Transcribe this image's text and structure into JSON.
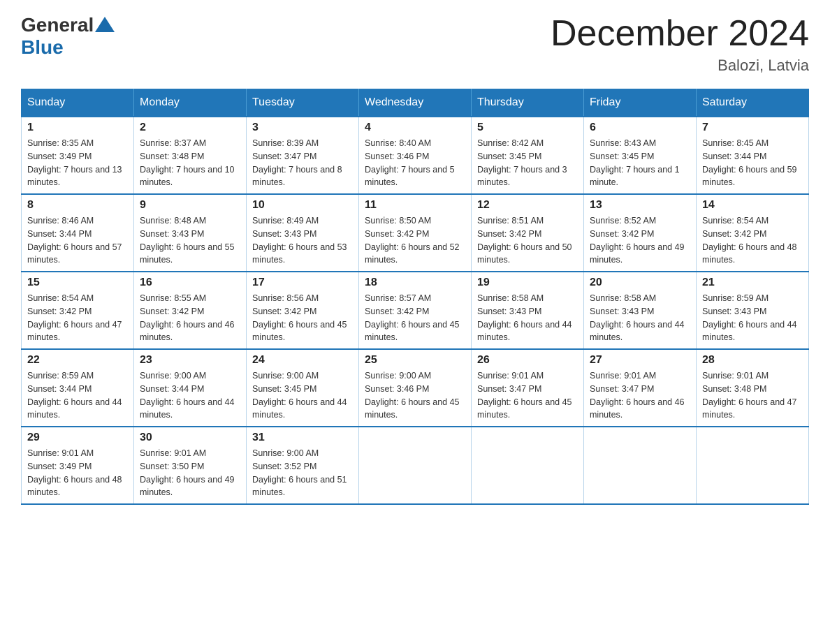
{
  "header": {
    "title": "December 2024",
    "location": "Balozi, Latvia",
    "logo_general": "General",
    "logo_blue": "Blue"
  },
  "days_of_week": [
    "Sunday",
    "Monday",
    "Tuesday",
    "Wednesday",
    "Thursday",
    "Friday",
    "Saturday"
  ],
  "weeks": [
    [
      {
        "day": "1",
        "sunrise": "8:35 AM",
        "sunset": "3:49 PM",
        "daylight": "7 hours and 13 minutes."
      },
      {
        "day": "2",
        "sunrise": "8:37 AM",
        "sunset": "3:48 PM",
        "daylight": "7 hours and 10 minutes."
      },
      {
        "day": "3",
        "sunrise": "8:39 AM",
        "sunset": "3:47 PM",
        "daylight": "7 hours and 8 minutes."
      },
      {
        "day": "4",
        "sunrise": "8:40 AM",
        "sunset": "3:46 PM",
        "daylight": "7 hours and 5 minutes."
      },
      {
        "day": "5",
        "sunrise": "8:42 AM",
        "sunset": "3:45 PM",
        "daylight": "7 hours and 3 minutes."
      },
      {
        "day": "6",
        "sunrise": "8:43 AM",
        "sunset": "3:45 PM",
        "daylight": "7 hours and 1 minute."
      },
      {
        "day": "7",
        "sunrise": "8:45 AM",
        "sunset": "3:44 PM",
        "daylight": "6 hours and 59 minutes."
      }
    ],
    [
      {
        "day": "8",
        "sunrise": "8:46 AM",
        "sunset": "3:44 PM",
        "daylight": "6 hours and 57 minutes."
      },
      {
        "day": "9",
        "sunrise": "8:48 AM",
        "sunset": "3:43 PM",
        "daylight": "6 hours and 55 minutes."
      },
      {
        "day": "10",
        "sunrise": "8:49 AM",
        "sunset": "3:43 PM",
        "daylight": "6 hours and 53 minutes."
      },
      {
        "day": "11",
        "sunrise": "8:50 AM",
        "sunset": "3:42 PM",
        "daylight": "6 hours and 52 minutes."
      },
      {
        "day": "12",
        "sunrise": "8:51 AM",
        "sunset": "3:42 PM",
        "daylight": "6 hours and 50 minutes."
      },
      {
        "day": "13",
        "sunrise": "8:52 AM",
        "sunset": "3:42 PM",
        "daylight": "6 hours and 49 minutes."
      },
      {
        "day": "14",
        "sunrise": "8:54 AM",
        "sunset": "3:42 PM",
        "daylight": "6 hours and 48 minutes."
      }
    ],
    [
      {
        "day": "15",
        "sunrise": "8:54 AM",
        "sunset": "3:42 PM",
        "daylight": "6 hours and 47 minutes."
      },
      {
        "day": "16",
        "sunrise": "8:55 AM",
        "sunset": "3:42 PM",
        "daylight": "6 hours and 46 minutes."
      },
      {
        "day": "17",
        "sunrise": "8:56 AM",
        "sunset": "3:42 PM",
        "daylight": "6 hours and 45 minutes."
      },
      {
        "day": "18",
        "sunrise": "8:57 AM",
        "sunset": "3:42 PM",
        "daylight": "6 hours and 45 minutes."
      },
      {
        "day": "19",
        "sunrise": "8:58 AM",
        "sunset": "3:43 PM",
        "daylight": "6 hours and 44 minutes."
      },
      {
        "day": "20",
        "sunrise": "8:58 AM",
        "sunset": "3:43 PM",
        "daylight": "6 hours and 44 minutes."
      },
      {
        "day": "21",
        "sunrise": "8:59 AM",
        "sunset": "3:43 PM",
        "daylight": "6 hours and 44 minutes."
      }
    ],
    [
      {
        "day": "22",
        "sunrise": "8:59 AM",
        "sunset": "3:44 PM",
        "daylight": "6 hours and 44 minutes."
      },
      {
        "day": "23",
        "sunrise": "9:00 AM",
        "sunset": "3:44 PM",
        "daylight": "6 hours and 44 minutes."
      },
      {
        "day": "24",
        "sunrise": "9:00 AM",
        "sunset": "3:45 PM",
        "daylight": "6 hours and 44 minutes."
      },
      {
        "day": "25",
        "sunrise": "9:00 AM",
        "sunset": "3:46 PM",
        "daylight": "6 hours and 45 minutes."
      },
      {
        "day": "26",
        "sunrise": "9:01 AM",
        "sunset": "3:47 PM",
        "daylight": "6 hours and 45 minutes."
      },
      {
        "day": "27",
        "sunrise": "9:01 AM",
        "sunset": "3:47 PM",
        "daylight": "6 hours and 46 minutes."
      },
      {
        "day": "28",
        "sunrise": "9:01 AM",
        "sunset": "3:48 PM",
        "daylight": "6 hours and 47 minutes."
      }
    ],
    [
      {
        "day": "29",
        "sunrise": "9:01 AM",
        "sunset": "3:49 PM",
        "daylight": "6 hours and 48 minutes."
      },
      {
        "day": "30",
        "sunrise": "9:01 AM",
        "sunset": "3:50 PM",
        "daylight": "6 hours and 49 minutes."
      },
      {
        "day": "31",
        "sunrise": "9:00 AM",
        "sunset": "3:52 PM",
        "daylight": "6 hours and 51 minutes."
      },
      null,
      null,
      null,
      null
    ]
  ],
  "labels": {
    "sunrise": "Sunrise:",
    "sunset": "Sunset:",
    "daylight": "Daylight:"
  }
}
